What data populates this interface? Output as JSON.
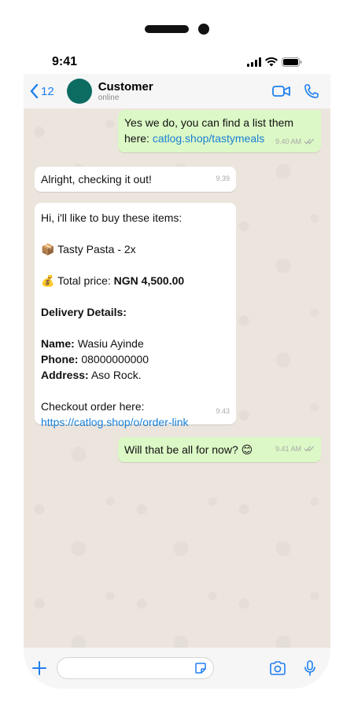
{
  "status": {
    "time": "9:41"
  },
  "header": {
    "back_count": "12",
    "contact_name": "Customer",
    "contact_status": "online"
  },
  "messages": {
    "m1": {
      "line1": "Yes we do, you can find a list them",
      "line2_prefix": "here: ",
      "link": "catlog.shop/tastymeals",
      "time": "9.40 AM"
    },
    "m2": {
      "text": "Alright, checking it out!",
      "time": "9.39"
    },
    "m3": {
      "intro": "Hi, i'll like to buy these items:",
      "item_emoji": "📦",
      "item": "Tasty Pasta - 2x",
      "total_emoji": "💰",
      "total_label": "Total price:",
      "total_value": "NGN 4,500.00",
      "delivery_heading": "Delivery Details:",
      "name_label": "Name:",
      "name_value": "Wasiu Ayinde",
      "phone_label": "Phone:",
      "phone_value": "08000000000",
      "address_label": "Address:",
      "address_value": "Aso Rock.",
      "checkout": "Checkout order here:",
      "link": "https://catlog.shop/o/order-link",
      "time": "9.43"
    },
    "m4": {
      "text": "Will that be all for now? ",
      "emoji": "😊",
      "time": "9.41 AM"
    }
  },
  "icons": {
    "back": "chevron-left-icon",
    "video": "video-camera-icon",
    "call": "phone-icon",
    "attach": "plus-icon",
    "sticker": "sticker-icon",
    "camera": "camera-icon",
    "mic": "microphone-icon"
  },
  "colors": {
    "accent": "#1e7ff0",
    "outgoing": "#dcf8c6",
    "incoming": "#ffffff",
    "chat_bg": "#ece5dd",
    "avatar": "#0d6c62"
  }
}
